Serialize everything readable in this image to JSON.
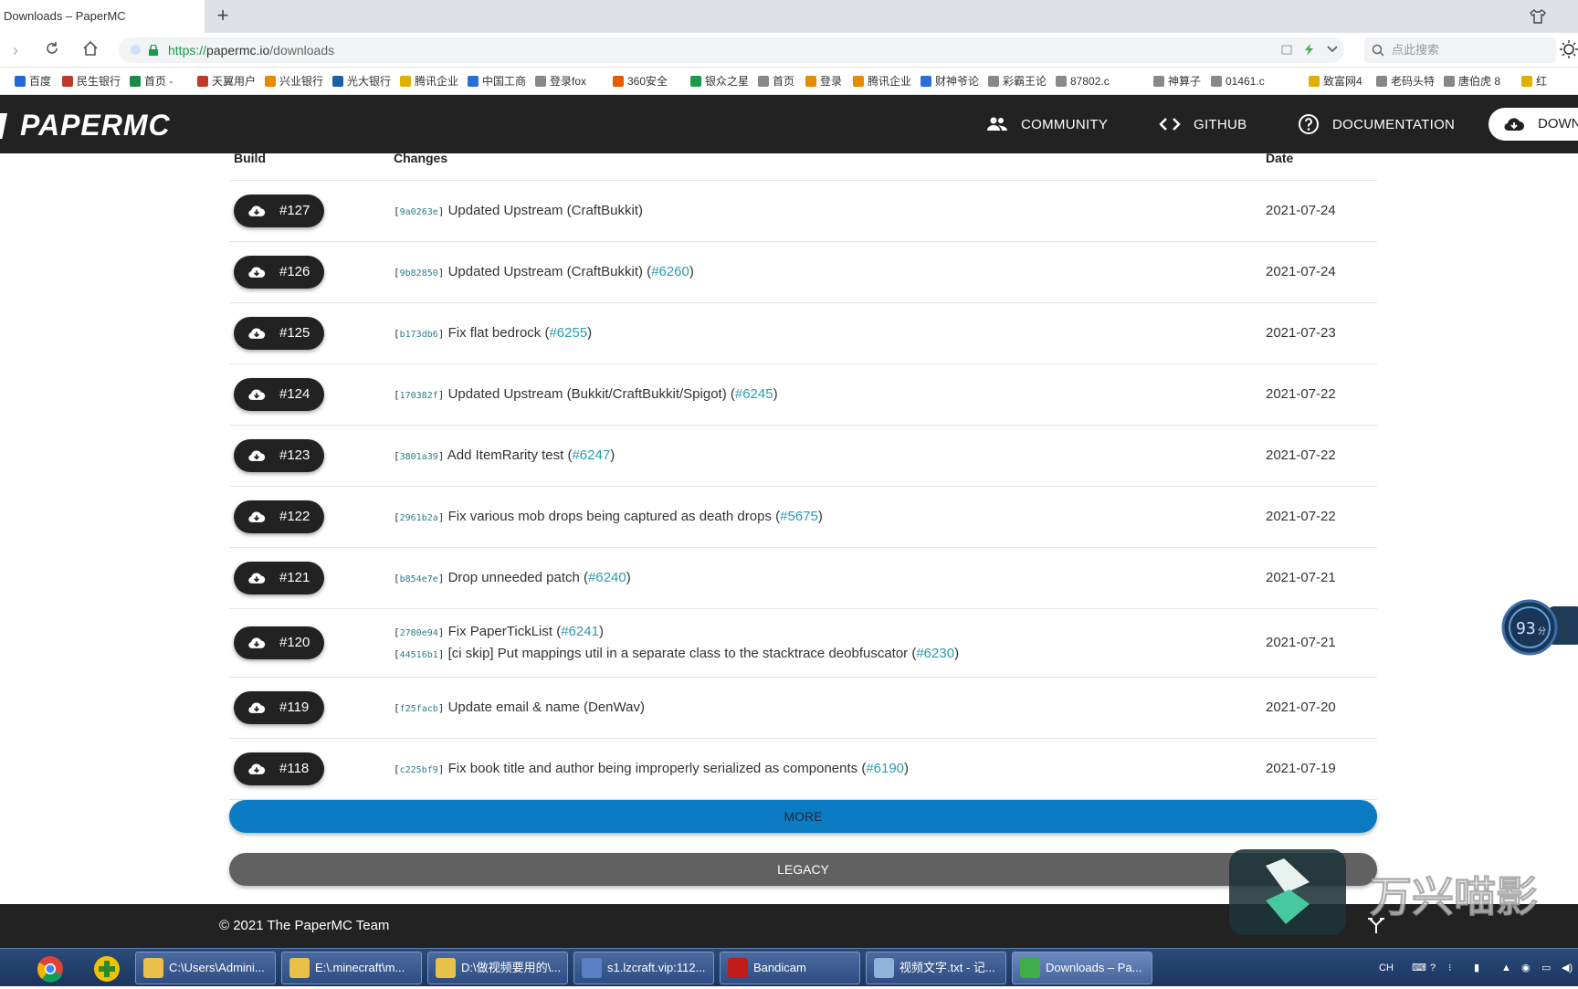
{
  "browser": {
    "tab_title": "Downloads – PaperMC",
    "new_tab": "+",
    "url_proto": "https://",
    "url_host": "papermc.io",
    "url_path": "/downloads",
    "search_placeholder": "点此搜索"
  },
  "bookmarks": [
    "百度",
    "民生银行",
    "首页 -",
    "天翼用户",
    "兴业银行",
    "光大银行",
    "腾讯企业",
    "中国工商",
    "登录fox",
    "360安全",
    "银众之星",
    "首页",
    "登录",
    "腾讯企业",
    "财神爷论",
    "彩霸王论",
    "87802.c",
    "神算子",
    "01461.c",
    "致富网4",
    "老码头特",
    "唐伯虎 8",
    "红"
  ],
  "site": {
    "logo": "PAPERMC",
    "nav": {
      "community": "COMMUNITY",
      "github": "GITHUB",
      "documentation": "DOCUMENTATION",
      "downloads": "DOWNLOADS"
    }
  },
  "table": {
    "headers": {
      "build": "Build",
      "changes": "Changes",
      "date": "Date"
    },
    "rows": [
      {
        "build": "#127",
        "commits": [
          {
            "hash": "9a0263e",
            "msg": "Updated Upstream (CraftBukkit)",
            "pr": ""
          }
        ],
        "date": "2021-07-24"
      },
      {
        "build": "#126",
        "commits": [
          {
            "hash": "9b82850",
            "msg": "Updated Upstream (CraftBukkit) (",
            "pr": "#6260"
          }
        ],
        "date": "2021-07-24"
      },
      {
        "build": "#125",
        "commits": [
          {
            "hash": "b173db6",
            "msg": "Fix flat bedrock (",
            "pr": "#6255"
          }
        ],
        "date": "2021-07-23"
      },
      {
        "build": "#124",
        "commits": [
          {
            "hash": "170382f",
            "msg": "Updated Upstream (Bukkit/CraftBukkit/Spigot) (",
            "pr": "#6245"
          }
        ],
        "date": "2021-07-22"
      },
      {
        "build": "#123",
        "commits": [
          {
            "hash": "3801a39",
            "msg": "Add ItemRarity test (",
            "pr": "#6247"
          }
        ],
        "date": "2021-07-22"
      },
      {
        "build": "#122",
        "commits": [
          {
            "hash": "2961b2a",
            "msg": "Fix various mob drops being captured as death drops (",
            "pr": "#5675"
          }
        ],
        "date": "2021-07-22"
      },
      {
        "build": "#121",
        "commits": [
          {
            "hash": "b854e7e",
            "msg": "Drop unneeded patch (",
            "pr": "#6240"
          }
        ],
        "date": "2021-07-21"
      },
      {
        "build": "#120",
        "commits": [
          {
            "hash": "2780e94",
            "msg": "Fix PaperTickList (",
            "pr": "#6241"
          },
          {
            "hash": "44516b1",
            "msg": "[ci skip] Put mappings util in a separate class to the stacktrace deobfuscator (",
            "pr": "#6230"
          }
        ],
        "date": "2021-07-21"
      },
      {
        "build": "#119",
        "commits": [
          {
            "hash": "f25facb",
            "msg": "Update email & name (DenWav)",
            "pr": ""
          }
        ],
        "date": "2021-07-20"
      },
      {
        "build": "#118",
        "commits": [
          {
            "hash": "c225bf9",
            "msg": "Fix book title and author being improperly serialized as components (",
            "pr": "#6190"
          }
        ],
        "date": "2021-07-19"
      }
    ]
  },
  "buttons": {
    "more": "MORE",
    "legacy": "LEGACY"
  },
  "footer": {
    "text": "© 2021 The PaperMC Team"
  },
  "overlay": {
    "speed_score": "93",
    "speed_unit": "分",
    "watermark": "万兴喵影"
  },
  "taskbar": {
    "items": [
      {
        "label": "C:\\Users\\Admini...",
        "icon": "folder-icon",
        "color": "#e8c14a"
      },
      {
        "label": "E:\\.minecraft\\m...",
        "icon": "folder-icon",
        "color": "#e8c14a"
      },
      {
        "label": "D:\\做视频要用的\\...",
        "icon": "folder-icon",
        "color": "#e8c14a"
      },
      {
        "label": "s1.lzcraft.vip:112...",
        "icon": "remote-desktop-icon",
        "color": "#5a7fc4"
      },
      {
        "label": "Bandicam",
        "icon": "record-icon",
        "color": "#c21b1b"
      },
      {
        "label": "视频文字.txt - 记...",
        "icon": "notepad-icon",
        "color": "#8fb3d9"
      },
      {
        "label": "Downloads – Pa...",
        "icon": "browser-icon",
        "color": "#3fae49"
      }
    ],
    "tray_lang": "CH"
  }
}
